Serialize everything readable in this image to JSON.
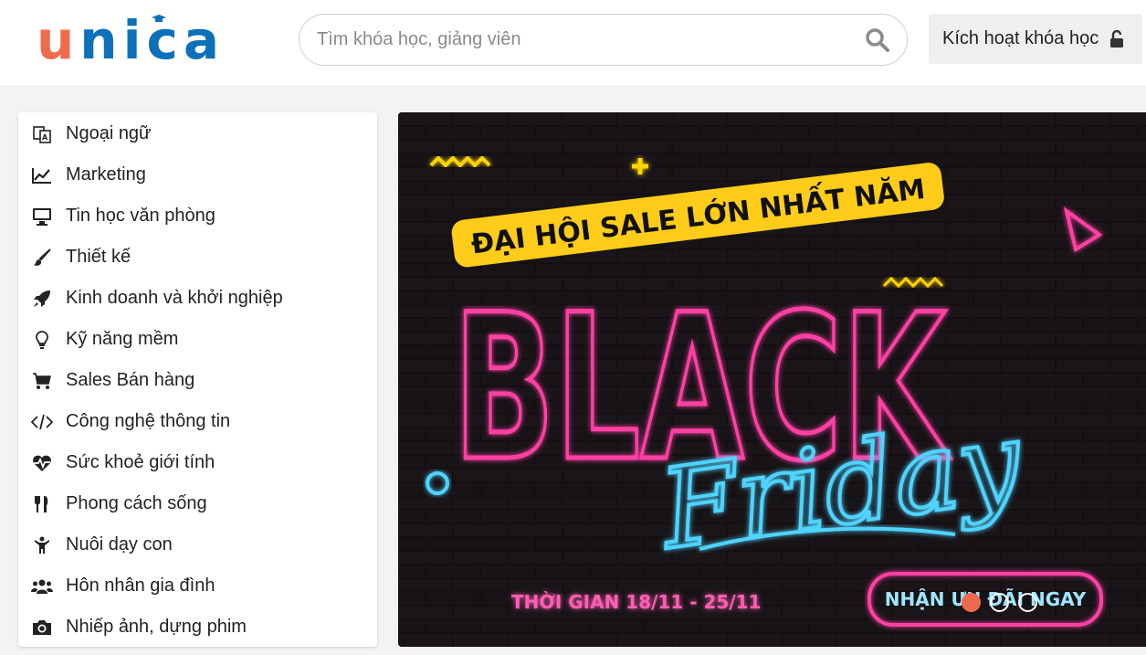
{
  "header": {
    "logo_first": "u",
    "logo_rest": "nica",
    "search_placeholder": "Tìm khóa học, giảng viên",
    "activate_label": "Kích hoạt khóa học"
  },
  "menu": {
    "items": [
      {
        "label": "Ngoại ngữ",
        "icon": "language-icon"
      },
      {
        "label": "Marketing",
        "icon": "chart-line-icon"
      },
      {
        "label": "Tin học văn phòng",
        "icon": "desktop-icon"
      },
      {
        "label": "Thiết kế",
        "icon": "paint-brush-icon"
      },
      {
        "label": "Kinh doanh và khởi nghiệp",
        "icon": "rocket-icon"
      },
      {
        "label": "Kỹ năng mềm",
        "icon": "lightbulb-icon"
      },
      {
        "label": "Sales Bán hàng",
        "icon": "cart-icon"
      },
      {
        "label": "Công nghệ thông tin",
        "icon": "code-icon"
      },
      {
        "label": "Sức khoẻ giới tính",
        "icon": "heartbeat-icon"
      },
      {
        "label": "Phong cách sống",
        "icon": "cutlery-icon"
      },
      {
        "label": "Nuôi dạy con",
        "icon": "child-icon"
      },
      {
        "label": "Hôn nhân gia đình",
        "icon": "users-icon"
      },
      {
        "label": "Nhiếp ảnh, dựng phim",
        "icon": "camera-icon"
      }
    ]
  },
  "banner": {
    "headline_small": "ĐẠI HỘI SALE LỚN NHẤT NĂM",
    "headline_big": "BLACK",
    "script": "Friday",
    "period": "THỜI GIAN 18/11 - 25/11",
    "cta": "NHẬN ƯU ĐÃI NGAY",
    "slides": 3,
    "active_slide": 1
  },
  "colors": {
    "brand_orange": "#ef6b4d",
    "brand_blue": "#0c71b9",
    "neon_pink": "#ff3fa4",
    "neon_blue": "#4fd4ff",
    "neon_yellow": "#ffd400"
  }
}
